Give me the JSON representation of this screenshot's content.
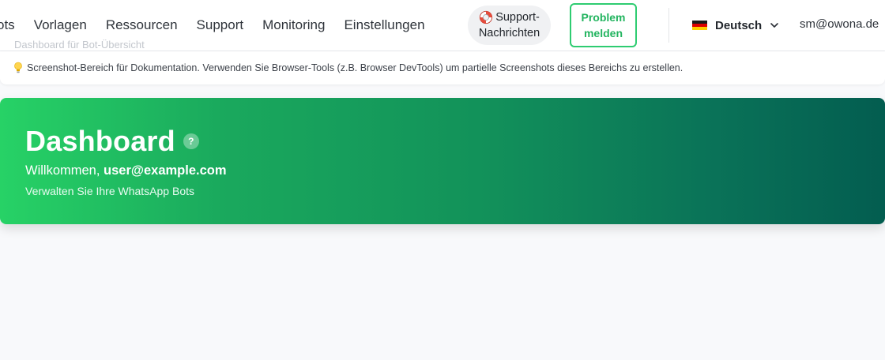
{
  "header": {
    "ghost_title": "Dashboard für Bot-Übersicht",
    "nav": [
      "ots",
      "Vorlagen",
      "Ressourcen",
      "Support",
      "Monitoring",
      "Einstellungen"
    ],
    "support_messages": {
      "line1": "Support-",
      "line2": "Nachrichten",
      "icon": "lifebuoy-icon"
    },
    "report_problem": {
      "line1": "Problem",
      "line2": "melden"
    },
    "language": {
      "label": "Deutsch",
      "flag": "german-flag-icon"
    },
    "user_email": "sm@owona.de"
  },
  "hint": {
    "icon": "lightbulb-icon",
    "text": "Screenshot-Bereich für Dokumentation. Verwenden Sie Browser-Tools (z.B. Browser DevTools) um partielle Screenshots dieses Bereichs zu erstellen."
  },
  "dashboard": {
    "title": "Dashboard",
    "help_label": "?",
    "welcome_prefix": "Willkommen,",
    "welcome_user": "user@example.com",
    "subtitle": "Verwalten Sie Ihre WhatsApp Bots"
  },
  "colors": {
    "accent_green": "#2ecc71",
    "gradient_start": "#27d266",
    "gradient_end": "#035d50",
    "background": "#f8f9fb"
  }
}
